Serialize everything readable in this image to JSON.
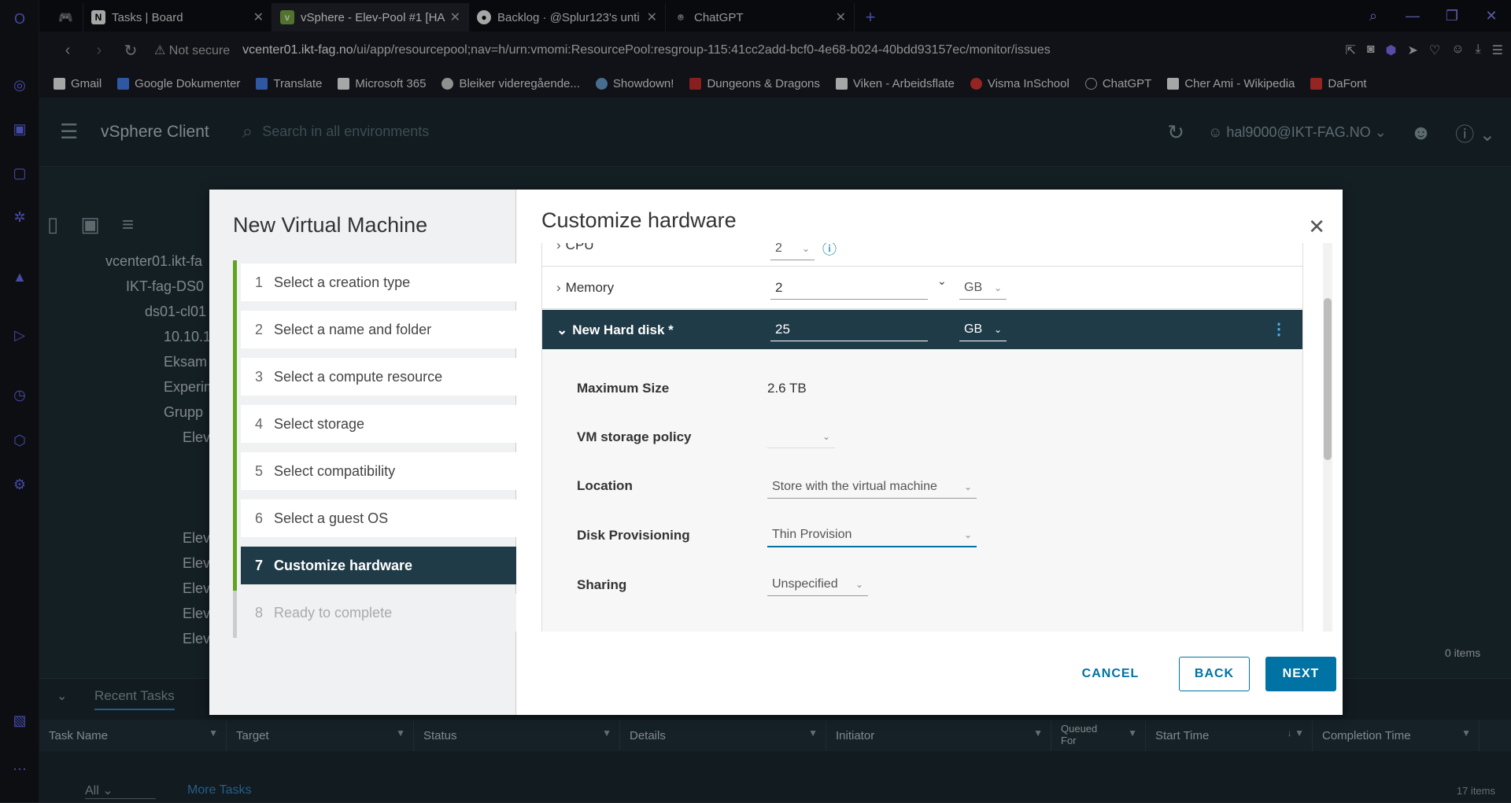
{
  "browser": {
    "tabs": [
      {
        "title": "Tasks | Board"
      },
      {
        "title": "vSphere - Elev-Pool #1 [HA"
      },
      {
        "title": "Backlog · @Splur123's unti"
      },
      {
        "title": "ChatGPT"
      }
    ],
    "not_secure": "Not secure",
    "url_host": "vcenter01.ikt-fag.no",
    "url_path": "/ui/app/resourcepool;nav=h/urn:vmomi:ResourcePool:resgroup-115:41cc2add-bcf0-4e68-b024-40bdd93157ec/monitor/issues",
    "bookmarks": [
      "Gmail",
      "Google Dokumenter",
      "Translate",
      "Microsoft 365",
      "Bleiker videregående...",
      "Showdown!",
      "Dungeons & Dragons",
      "Viken - Arbeidsflate",
      "Visma InSchool",
      "ChatGPT",
      "Cher Ami - Wikipedia",
      "DaFont"
    ]
  },
  "vsphere": {
    "title": "vSphere Client",
    "search_placeholder": "Search in all environments",
    "user": "hal9000@IKT-FAG.NO"
  },
  "background": {
    "tree": [
      "vcenter01.ikt-fa",
      "IKT-fag-DS0",
      "ds01-cl01",
      "10.10.1.",
      "Eksam",
      "Experim",
      "Grupp",
      "Elev",
      "Elev",
      "Elev",
      "Elev",
      "Elev",
      "Elev"
    ],
    "items_label": "0 items",
    "recent_tasks": "Recent Tasks",
    "columns": [
      "Task Name",
      "Target",
      "Status",
      "Details",
      "Initiator",
      "Queued For",
      "Start Time",
      "Completion Time"
    ],
    "filter_value": "All",
    "more_tasks": "More Tasks",
    "task_count": "17 items"
  },
  "wizard": {
    "title": "New Virtual Machine",
    "steps": [
      {
        "num": "1",
        "label": "Select a creation type"
      },
      {
        "num": "2",
        "label": "Select a name and folder"
      },
      {
        "num": "3",
        "label": "Select a compute resource"
      },
      {
        "num": "4",
        "label": "Select storage"
      },
      {
        "num": "5",
        "label": "Select compatibility"
      },
      {
        "num": "6",
        "label": "Select a guest OS"
      },
      {
        "num": "7",
        "label": "Customize hardware"
      },
      {
        "num": "8",
        "label": "Ready to complete"
      }
    ]
  },
  "hardware": {
    "title": "Customize hardware",
    "cpu": {
      "label": "CPU",
      "value": "2"
    },
    "memory": {
      "label": "Memory",
      "value": "2",
      "unit": "GB"
    },
    "disk": {
      "label": "New Hard disk *",
      "value": "25",
      "unit": "GB"
    },
    "details": {
      "max_size_label": "Maximum Size",
      "max_size_value": "2.6 TB",
      "policy_label": "VM storage policy",
      "policy_value": "",
      "location_label": "Location",
      "location_value": "Store with the virtual machine",
      "provisioning_label": "Disk Provisioning",
      "provisioning_value": "Thin Provision",
      "sharing_label": "Sharing",
      "sharing_value": "Unspecified"
    }
  },
  "buttons": {
    "cancel": "CANCEL",
    "back": "BACK",
    "next": "NEXT"
  }
}
